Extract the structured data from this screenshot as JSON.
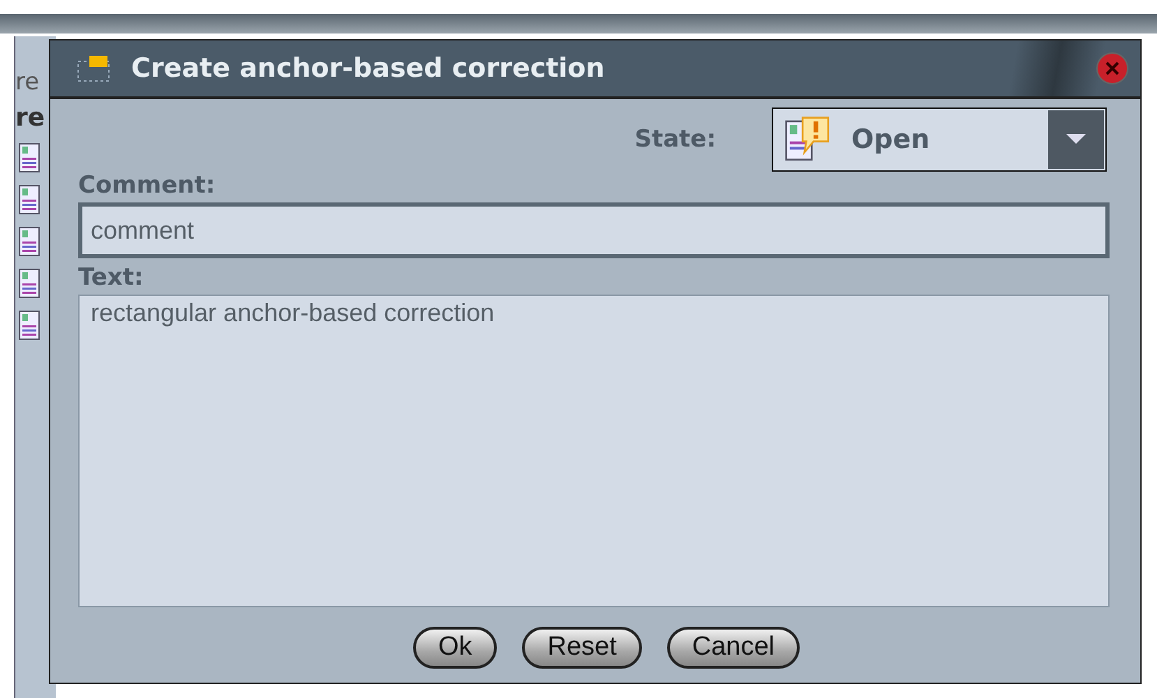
{
  "background": {
    "texts": [
      "re",
      "re"
    ]
  },
  "dialog": {
    "title": "Create anchor-based correction",
    "state": {
      "label": "State:",
      "value": "Open"
    },
    "comment": {
      "label": "Comment:",
      "value": "comment"
    },
    "text": {
      "label": "Text:",
      "value": "rectangular anchor-based correction"
    },
    "buttons": [
      "Ok",
      "Reset",
      "Cancel"
    ]
  }
}
